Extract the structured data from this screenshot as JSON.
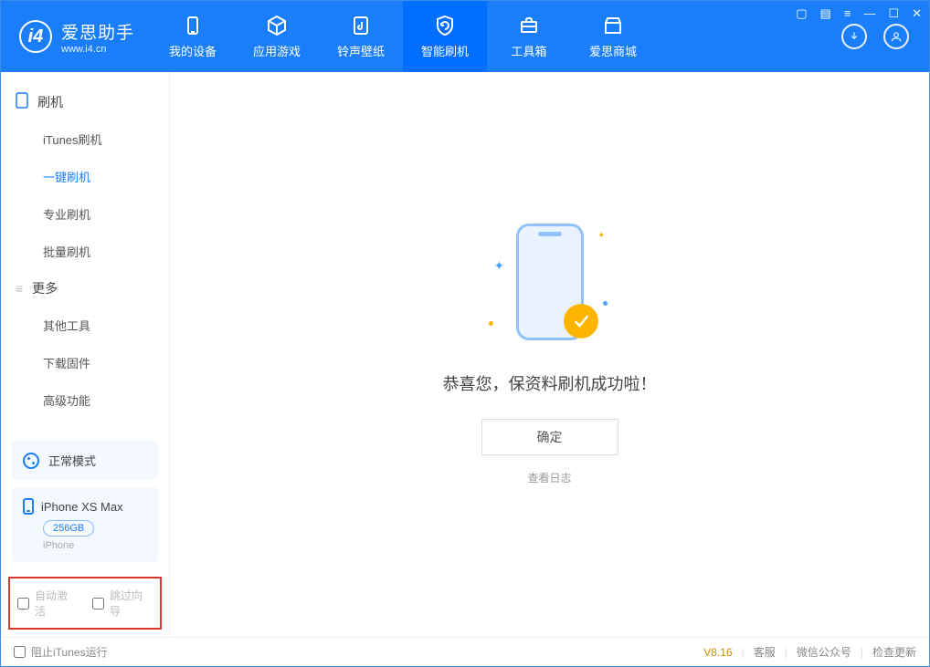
{
  "app": {
    "title": "爱思助手",
    "subtitle": "www.i4.cn"
  },
  "tabs": [
    {
      "label": "我的设备"
    },
    {
      "label": "应用游戏"
    },
    {
      "label": "铃声壁纸"
    },
    {
      "label": "智能刷机"
    },
    {
      "label": "工具箱"
    },
    {
      "label": "爱思商城"
    }
  ],
  "sidebar": {
    "section1": {
      "title": "刷机",
      "items": [
        "iTunes刷机",
        "一键刷机",
        "专业刷机",
        "批量刷机"
      ]
    },
    "section2": {
      "title": "更多",
      "items": [
        "其他工具",
        "下载固件",
        "高级功能"
      ]
    },
    "status": "正常模式",
    "device": {
      "name": "iPhone XS Max",
      "capacity": "256GB",
      "type": "iPhone"
    },
    "checkboxes": {
      "auto_activate": "自动激活",
      "skip_guide": "跳过向导"
    }
  },
  "main": {
    "success_text": "恭喜您，保资料刷机成功啦！",
    "ok_label": "确定",
    "log_link": "查看日志"
  },
  "footer": {
    "block_itunes": "阻止iTunes运行",
    "version": "V8.16",
    "links": [
      "客服",
      "微信公众号",
      "检查更新"
    ]
  }
}
